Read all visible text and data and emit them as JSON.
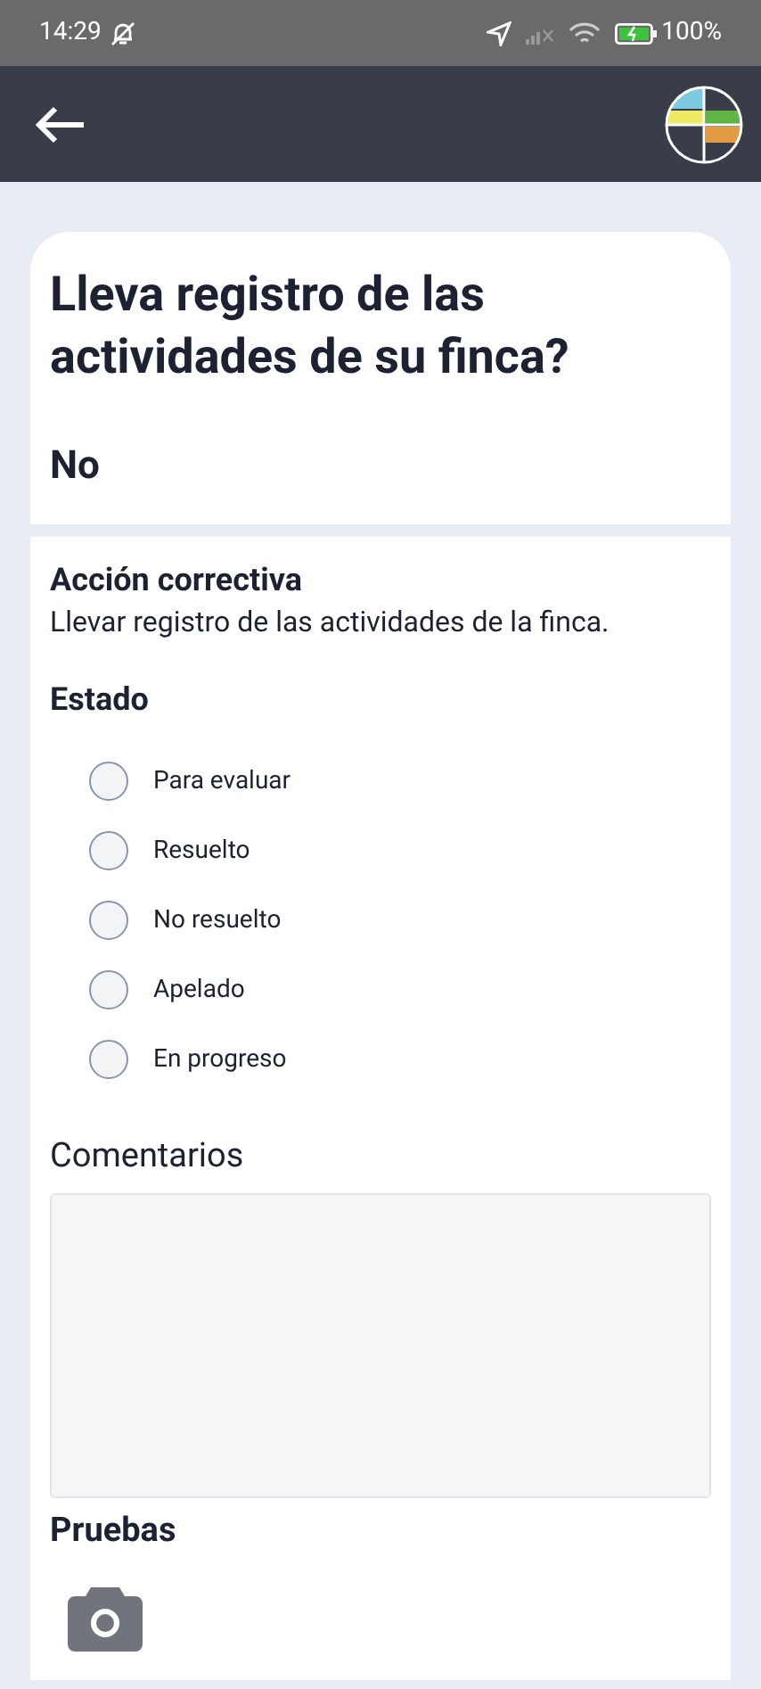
{
  "status_bar": {
    "time": "14:29",
    "battery": "100%"
  },
  "question": {
    "title": "Lleva registro de las actividades de su finca?",
    "answer": "No"
  },
  "corrective": {
    "label": "Acción correctiva",
    "text": "Llevar registro de las actividades de la finca."
  },
  "state": {
    "label": "Estado",
    "options": [
      {
        "label": "Para evaluar",
        "selected": false
      },
      {
        "label": "Resuelto",
        "selected": false
      },
      {
        "label": "No resuelto",
        "selected": false
      },
      {
        "label": "Apelado",
        "selected": false
      },
      {
        "label": "En progreso",
        "selected": false
      }
    ]
  },
  "comments": {
    "label": "Comentarios"
  },
  "evidence": {
    "label": "Pruebas"
  }
}
